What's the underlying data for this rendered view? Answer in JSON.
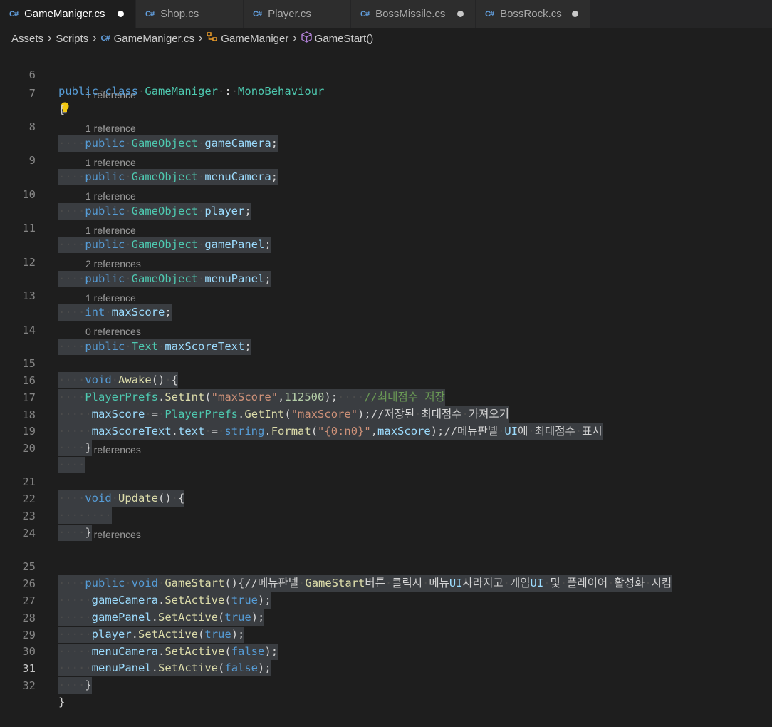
{
  "tabs": [
    {
      "label": "GameManiger.cs",
      "active": true,
      "modified": true
    },
    {
      "label": "Shop.cs",
      "active": false,
      "modified": false
    },
    {
      "label": "Player.cs",
      "active": false,
      "modified": false
    },
    {
      "label": "BossMissile.cs",
      "active": false,
      "modified": true
    },
    {
      "label": "BossRock.cs",
      "active": false,
      "modified": true
    }
  ],
  "tab_icon_text": "C#",
  "breadcrumb": {
    "items": [
      "Assets",
      "Scripts",
      "GameManiger.cs",
      "GameManiger",
      "GameStart()"
    ]
  },
  "colors": {
    "keyword": "#569cd6",
    "type": "#4ec9b0",
    "function": "#dcdcaa",
    "string": "#ce9178",
    "number": "#b5cea8",
    "comment": "#6a9955"
  },
  "icons": {
    "file": "csharp-file-icon",
    "class": "class-icon",
    "method": "method-cube-icon",
    "bulb": "lightbulb-icon"
  },
  "code_lens": {
    "l8": "1 reference",
    "l9": "1 reference",
    "l10": "1 reference",
    "l11": "1 reference",
    "l12": "1 reference",
    "l13": "2 references",
    "l14": "1 reference",
    "l15": "0 references",
    "l21": "0 references",
    "l25": "0 references"
  },
  "lines": [
    {
      "n": "6",
      "text": "public class GameManiger : MonoBehaviour"
    },
    {
      "n": "7",
      "text": "{"
    },
    {
      "n": "8",
      "text": "    public GameObject gameCamera;"
    },
    {
      "n": "9",
      "text": "    public GameObject menuCamera;"
    },
    {
      "n": "10",
      "text": "    public GameObject player;"
    },
    {
      "n": "11",
      "text": "    public GameObject gamePanel;"
    },
    {
      "n": "12",
      "text": "    public GameObject menuPanel;"
    },
    {
      "n": "13",
      "text": "    int maxScore;"
    },
    {
      "n": "14",
      "text": "    public Text maxScoreText;"
    },
    {
      "n": "15",
      "text": "    void Awake() {"
    },
    {
      "n": "16",
      "text": "    PlayerPrefs.SetInt(\"maxScore\",112500);    //최대점수 저장"
    },
    {
      "n": "17",
      "text": "     maxScore = PlayerPrefs.GetInt(\"maxScore\");//저장된 최대점수 가져오기"
    },
    {
      "n": "18",
      "text": "     maxScoreText.text = string.Format(\"{0:n0}\",maxScore);//메뉴판넬 UI에 최대점수 표시"
    },
    {
      "n": "19",
      "text": "    }"
    },
    {
      "n": "20",
      "text": "    "
    },
    {
      "n": "21",
      "text": "    void Update() {"
    },
    {
      "n": "22",
      "text": "        "
    },
    {
      "n": "23",
      "text": "    }"
    },
    {
      "n": "24",
      "text": ""
    },
    {
      "n": "25",
      "text": "    public void GameStart(){//메뉴판넬 GameStart버튼 클릭시 메뉴UI사라지고 게임UI 및 플레이어 활성화 시킴"
    },
    {
      "n": "26",
      "text": "     gameCamera.SetActive(true);"
    },
    {
      "n": "27",
      "text": "     gamePanel.SetActive(true);"
    },
    {
      "n": "28",
      "text": "     player.SetActive(true);"
    },
    {
      "n": "29",
      "text": "     menuCamera.SetActive(false);"
    },
    {
      "n": "30",
      "text": "     menuPanel.SetActive(false);"
    },
    {
      "n": "31",
      "text": "    }"
    },
    {
      "n": "32",
      "text": "}"
    }
  ]
}
